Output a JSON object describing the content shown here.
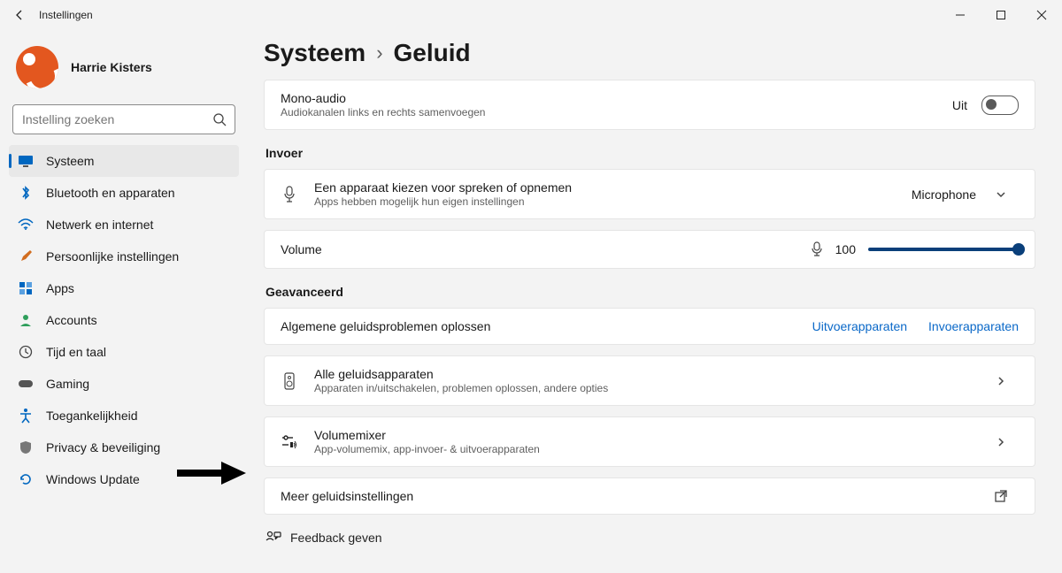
{
  "window": {
    "title": "Instellingen"
  },
  "user": {
    "name": "Harrie Kisters"
  },
  "search": {
    "placeholder": "Instelling zoeken"
  },
  "nav": [
    {
      "label": "Systeem",
      "selected": true
    },
    {
      "label": "Bluetooth en apparaten"
    },
    {
      "label": "Netwerk en internet"
    },
    {
      "label": "Persoonlijke instellingen"
    },
    {
      "label": "Apps"
    },
    {
      "label": "Accounts"
    },
    {
      "label": "Tijd en taal"
    },
    {
      "label": "Gaming"
    },
    {
      "label": "Toegankelijkheid"
    },
    {
      "label": "Privacy & beveiliging"
    },
    {
      "label": "Windows Update"
    }
  ],
  "crumb": {
    "parent": "Systeem",
    "current": "Geluid"
  },
  "mono": {
    "title": "Mono-audio",
    "sub": "Audiokanalen links en rechts samenvoegen",
    "state": "Uit"
  },
  "sections": {
    "input": "Invoer",
    "advanced": "Geavanceerd"
  },
  "inputDevice": {
    "title": "Een apparaat kiezen voor spreken of opnemen",
    "sub": "Apps hebben mogelijk hun eigen instellingen",
    "selected": "Microphone"
  },
  "volume": {
    "label": "Volume",
    "value": "100"
  },
  "troubleshoot": {
    "title": "Algemene geluidsproblemen oplossen",
    "out": "Uitvoerapparaten",
    "in": "Invoerapparaten"
  },
  "allDevices": {
    "title": "Alle geluidsapparaten",
    "sub": "Apparaten in/uitschakelen, problemen oplossen, andere opties"
  },
  "mixer": {
    "title": "Volumemixer",
    "sub": "App-volumemix, app-invoer- & uitvoerapparaten"
  },
  "more": {
    "title": "Meer geluidsinstellingen"
  },
  "feedback": {
    "label": "Feedback geven"
  }
}
